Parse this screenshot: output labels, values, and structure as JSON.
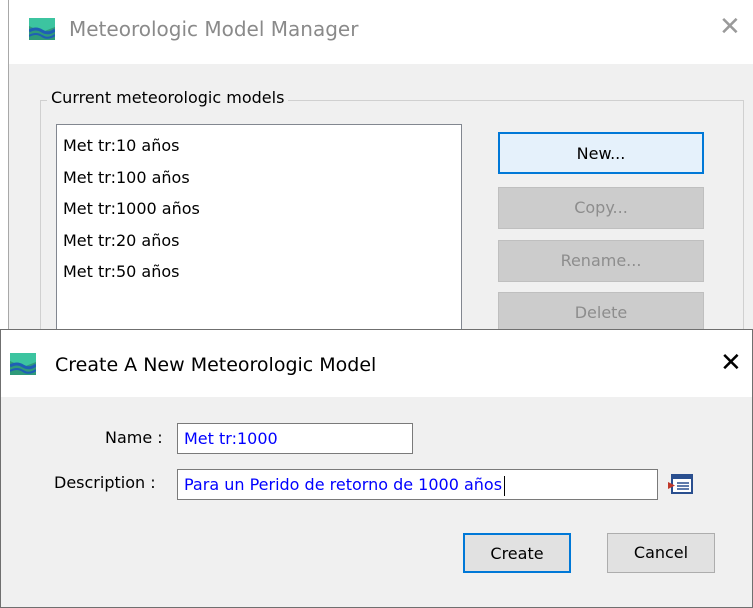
{
  "manager": {
    "title": "Meteorologic Model Manager",
    "close_glyph": "✕",
    "group_label": "Current meteorologic models",
    "models": [
      "Met tr:10 años",
      "Met tr:100 años",
      "Met tr:1000 años",
      "Met tr:20 años",
      "Met tr:50 años"
    ],
    "buttons": {
      "new": "New...",
      "copy": "Copy...",
      "rename": "Rename...",
      "delete": "Delete"
    }
  },
  "dialog": {
    "title": "Create A New Meteorologic Model",
    "close_glyph": "✕",
    "name_label": "Name :",
    "name_value": "Met tr:1000",
    "description_label": "Description :",
    "description_value": "Para un Perido de retorno de 1000 años",
    "create_label": "Create",
    "cancel_label": "Cancel"
  },
  "colors": {
    "accent": "#0078d7",
    "input_text": "#0000ff",
    "window_bg": "#f0f0f0"
  },
  "icons": {
    "app": "hec-hms-app-icon",
    "description_editor": "text-editor-icon"
  }
}
